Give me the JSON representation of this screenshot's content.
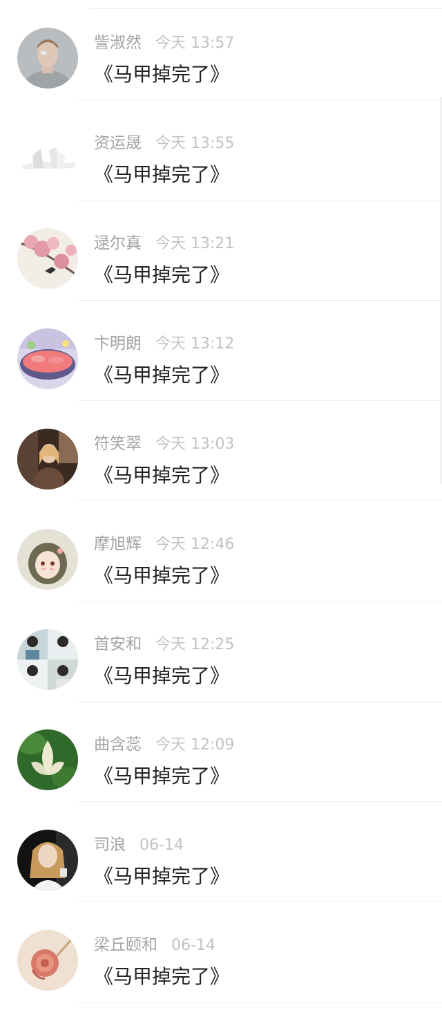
{
  "messages": [
    {
      "name": "訾淑然",
      "time": "今天 13:57",
      "text": "《马甲掉完了》",
      "avatar_icon": "boy-portrait-avatar"
    },
    {
      "name": "资运晟",
      "time": "今天 13:55",
      "text": "《马甲掉完了》",
      "avatar_icon": "sketch-scenery-avatar"
    },
    {
      "name": "逯尔真",
      "time": "今天 13:21",
      "text": "《马甲掉完了》",
      "avatar_icon": "blossom-bird-avatar"
    },
    {
      "name": "卞明朗",
      "time": "今天 13:12",
      "text": "《马甲掉完了》",
      "avatar_icon": "food-bowl-avatar"
    },
    {
      "name": "符笑翠",
      "time": "今天 13:03",
      "text": "《马甲掉完了》",
      "avatar_icon": "cafe-girl-avatar"
    },
    {
      "name": "摩旭辉",
      "time": "今天 12:46",
      "text": "《马甲掉完了》",
      "avatar_icon": "anime-girl-avatar"
    },
    {
      "name": "首安和",
      "time": "今天 12:25",
      "text": "《马甲掉完了》",
      "avatar_icon": "collage-boys-avatar"
    },
    {
      "name": "曲含蕊",
      "time": "今天 12:09",
      "text": "《马甲掉完了》",
      "avatar_icon": "lotus-flower-avatar"
    },
    {
      "name": "司浪",
      "time": "06-14",
      "text": "《马甲掉完了》",
      "avatar_icon": "woman-portrait-avatar"
    },
    {
      "name": "梁丘颐和",
      "time": "06-14",
      "text": "《马甲掉完了》",
      "avatar_icon": "pink-rose-avatar"
    }
  ]
}
